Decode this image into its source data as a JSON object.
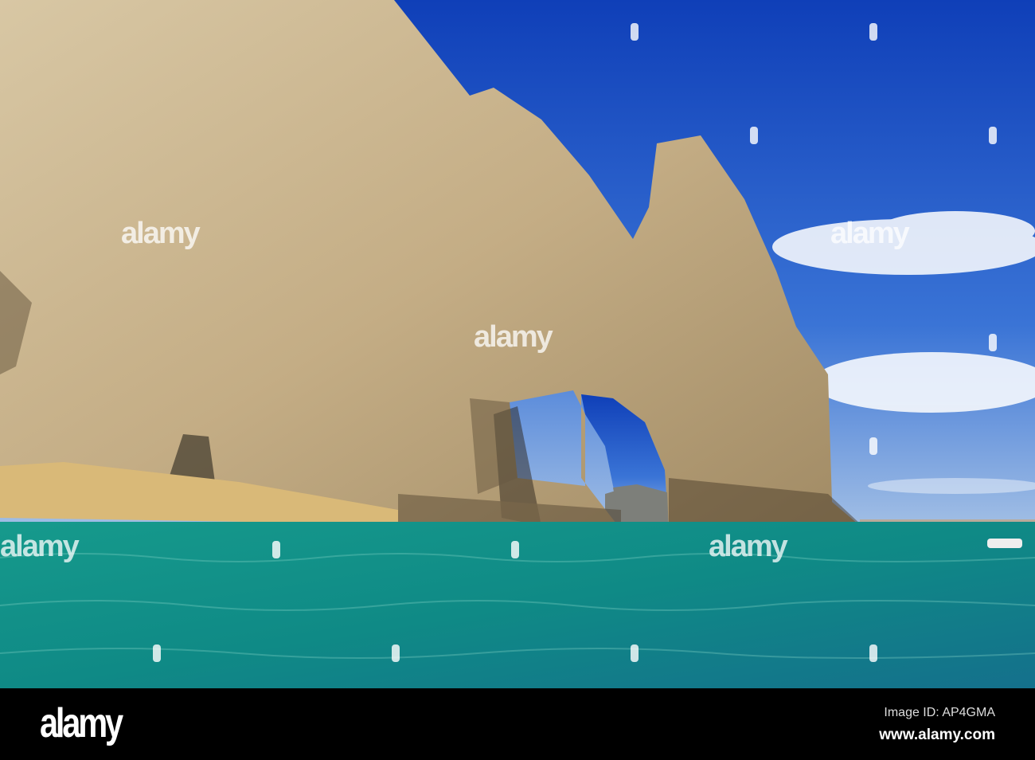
{
  "watermark": {
    "text": "alamy"
  },
  "banner": {
    "logo": "alamy",
    "image_id": "Image ID: AP4GMA",
    "website": "www.alamy.com"
  },
  "colors": {
    "sky": "#1a4fc4",
    "sea": "#118a88",
    "rock": "#cdb894",
    "sand": "#d9b978"
  }
}
